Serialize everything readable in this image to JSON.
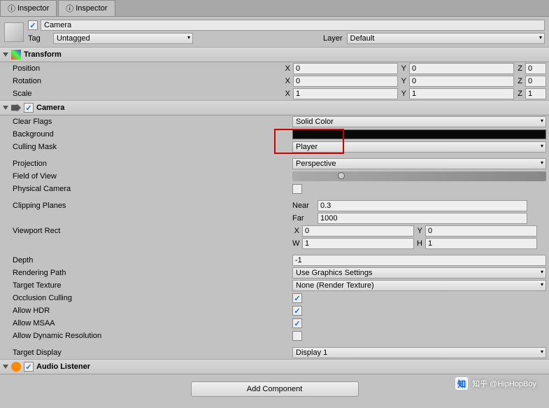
{
  "tabs": [
    "Inspector",
    "Inspector"
  ],
  "object": {
    "name": "Camera",
    "enabled": true,
    "tag_label": "Tag",
    "tag_value": "Untagged",
    "layer_label": "Layer",
    "layer_value": "Default"
  },
  "transform": {
    "title": "Transform",
    "position_label": "Position",
    "position": {
      "x": "0",
      "y": "0",
      "z": "0"
    },
    "rotation_label": "Rotation",
    "rotation": {
      "x": "0",
      "y": "0",
      "z": "0"
    },
    "scale_label": "Scale",
    "scale": {
      "x": "1",
      "y": "1",
      "z": "1"
    }
  },
  "camera": {
    "title": "Camera",
    "clear_flags_label": "Clear Flags",
    "clear_flags": "Solid Color",
    "background_label": "Background",
    "background_color": "#0a0a0a",
    "culling_mask_label": "Culling Mask",
    "culling_mask": "Player",
    "projection_label": "Projection",
    "projection": "Perspective",
    "fov_label": "Field of View",
    "physical_label": "Physical Camera",
    "physical": false,
    "clipping_label": "Clipping Planes",
    "near_label": "Near",
    "near": "0.3",
    "far_label": "Far",
    "far": "1000",
    "viewport_label": "Viewport Rect",
    "viewport": {
      "x": "0",
      "y": "0",
      "w": "1",
      "h": "1"
    },
    "depth_label": "Depth",
    "depth": "-1",
    "rendering_path_label": "Rendering Path",
    "rendering_path": "Use Graphics Settings",
    "target_texture_label": "Target Texture",
    "target_texture": "None (Render Texture)",
    "occlusion_label": "Occlusion Culling",
    "occlusion": true,
    "hdr_label": "Allow HDR",
    "hdr": true,
    "msaa_label": "Allow MSAA",
    "msaa": true,
    "dynres_label": "Allow Dynamic Resolution",
    "dynres": false,
    "target_display_label": "Target Display",
    "target_display": "Display 1"
  },
  "audio": {
    "title": "Audio Listener"
  },
  "add_component": "Add Component",
  "watermark": "知乎 @HipHopBoy",
  "axis": {
    "x": "X",
    "y": "Y",
    "z": "Z",
    "w": "W",
    "h": "H"
  }
}
